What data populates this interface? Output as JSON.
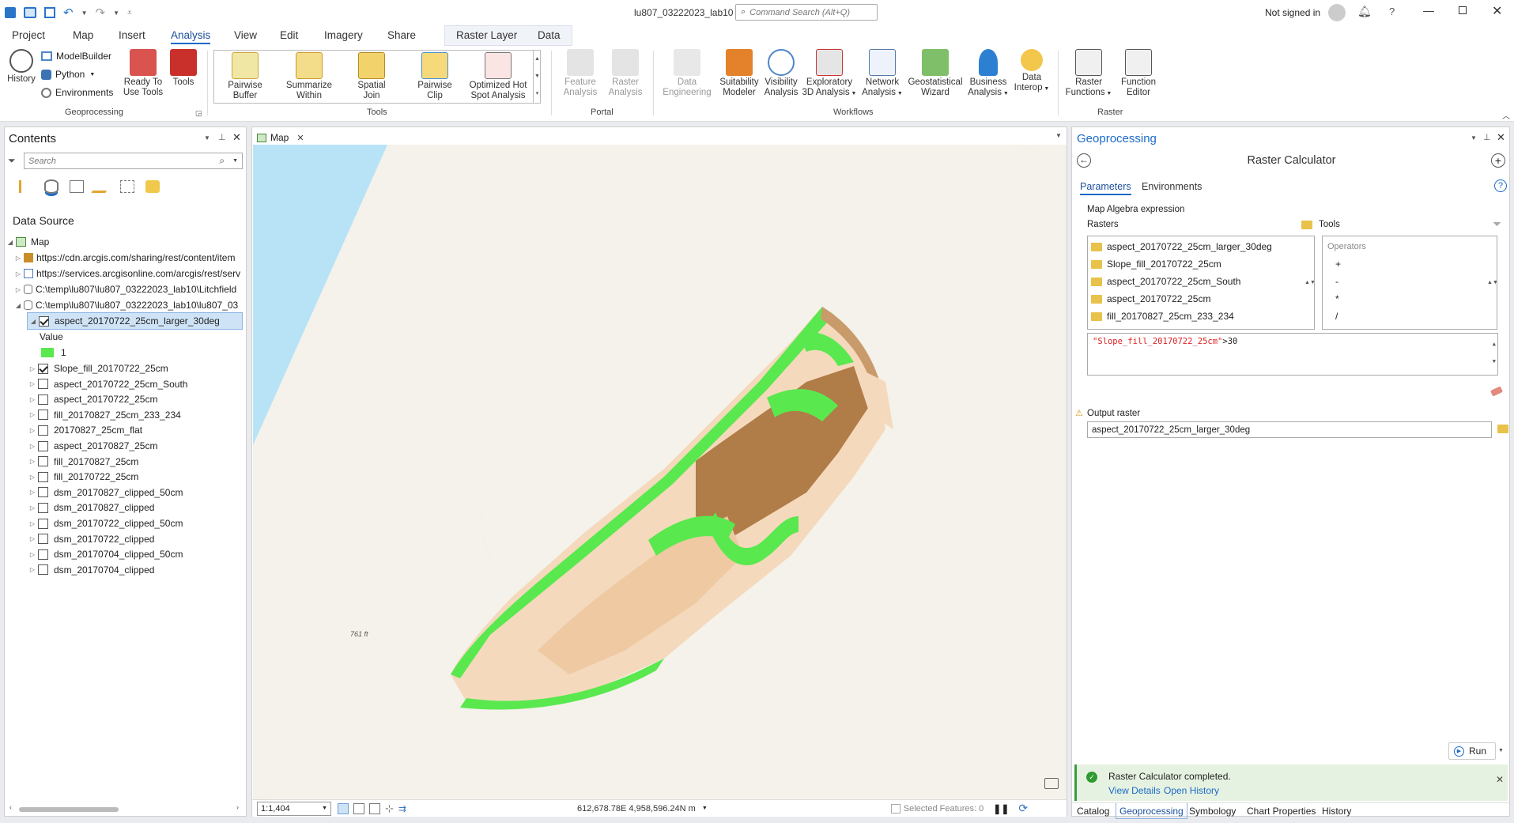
{
  "window": {
    "title": "lu807_03222023_lab10",
    "command_search_placeholder": "Command Search (Alt+Q)",
    "signed_in": "Not signed in"
  },
  "menu_tabs": [
    "Project",
    "Map",
    "Insert",
    "Analysis",
    "View",
    "Edit",
    "Imagery",
    "Share",
    "Raster Layer",
    "Data"
  ],
  "ribbon": {
    "geoprocessing": {
      "history": "History",
      "modelbuilder": "ModelBuilder",
      "python": "Python",
      "environments": "Environments",
      "ready": "Ready To",
      "ready2": "Use Tools",
      "tools": "Tools",
      "group": "Geoprocessing"
    },
    "tools": {
      "items": [
        [
          "Pairwise",
          "Buffer"
        ],
        [
          "Summarize",
          "Within"
        ],
        [
          "Spatial",
          "Join"
        ],
        [
          "Pairwise",
          "Clip"
        ],
        [
          "Optimized Hot",
          "Spot Analysis"
        ]
      ],
      "group": "Tools"
    },
    "portal": {
      "items": [
        [
          "Feature",
          "Analysis"
        ],
        [
          "Raster",
          "Analysis"
        ]
      ],
      "group": "Portal"
    },
    "workflows": {
      "items": [
        [
          "Data",
          "Engineering"
        ],
        [
          "Suitability",
          "Modeler"
        ],
        [
          "Visibility",
          "Analysis"
        ],
        [
          "Exploratory",
          "3D Analysis"
        ],
        [
          "Network",
          "Analysis"
        ],
        [
          "Geostatistical",
          "Wizard"
        ],
        [
          "Business",
          "Analysis"
        ],
        [
          "Data",
          "Interop"
        ]
      ],
      "group": "Workflows"
    },
    "raster": {
      "items": [
        [
          "Raster",
          "Functions"
        ],
        [
          "Function",
          "Editor"
        ]
      ],
      "group": "Raster"
    }
  },
  "contents": {
    "title": "Contents",
    "search_placeholder": "Search",
    "heading": "Data Source",
    "map": "Map",
    "sources": [
      "https://cdn.arcgis.com/sharing/rest/content/item",
      "https://services.arcgisonline.com/arcgis/rest/serv",
      "C:\\temp\\lu807\\lu807_03222023_lab10\\Litchfield",
      "C:\\temp\\lu807\\lu807_03222023_lab10\\lu807_03"
    ],
    "selected_layer": "aspect_20170722_25cm_larger_30deg",
    "legend_label": "Value",
    "legend_value": "1",
    "layers": [
      "Slope_fill_20170722_25cm",
      "aspect_20170722_25cm_South",
      "aspect_20170722_25cm",
      "fill_20170827_25cm_233_234",
      "20170827_25cm_flat",
      "aspect_20170827_25cm",
      "fill_20170827_25cm",
      "fill_20170722_25cm",
      "dsm_20170827_clipped_50cm",
      "dsm_20170827_clipped",
      "dsm_20170722_clipped_50cm",
      "dsm_20170722_clipped",
      "dsm_20170704_clipped_50cm",
      "dsm_20170704_clipped"
    ],
    "layers_checked": [
      true,
      false,
      false,
      false,
      false,
      false,
      false,
      false,
      false,
      false,
      false,
      false,
      false,
      false
    ]
  },
  "map": {
    "tab": "Map",
    "scale": "1:1,404",
    "coords": "612,678.78E 4,958,596.24N m",
    "selected_features": "Selected Features: 0",
    "annotation": "761 ft"
  },
  "geoprocessing": {
    "title": "Geoprocessing",
    "tool": "Raster Calculator",
    "tab_parameters": "Parameters",
    "tab_environments": "Environments",
    "expr_label": "Map Algebra expression",
    "rasters_label": "Rasters",
    "tools_label": "Tools",
    "rasters": [
      "aspect_20170722_25cm_larger_30deg",
      "Slope_fill_20170722_25cm",
      "aspect_20170722_25cm_South",
      "aspect_20170722_25cm",
      "fill_20170827_25cm_233_234"
    ],
    "operators_label": "Operators",
    "operators": [
      "+",
      "-",
      "*",
      "/"
    ],
    "expression_raster": "\"Slope_fill_20170722_25cm\"",
    "expression_rest": ">30",
    "output_label": "Output raster",
    "output_value": "aspect_20170722_25cm_larger_30deg",
    "run": "Run",
    "status": "Raster Calculator completed.",
    "view_details": "View Details",
    "open_history": "Open History"
  },
  "bottom_tabs": [
    "Catalog",
    "Geoprocessing",
    "Symbology",
    "Chart Properties",
    "History"
  ],
  "colors": {
    "accent": "#1b6ac9",
    "water": "#b8e3f7",
    "shore": "#f4f2ea",
    "green": "#59e84e",
    "terrain": "#a06a35"
  }
}
